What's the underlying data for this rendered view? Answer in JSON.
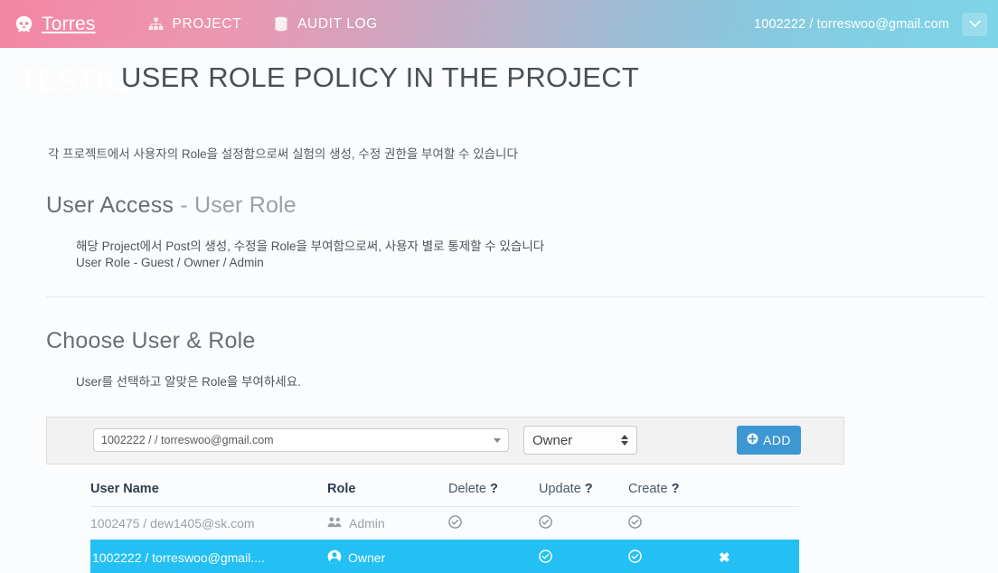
{
  "navbar": {
    "brand": "Torres",
    "brand_icon": "octocat-icon",
    "links": [
      {
        "label": "PROJECT",
        "icon": "sitemap-icon"
      },
      {
        "label": "AUDIT LOG",
        "icon": "database-icon"
      }
    ],
    "user": "1002222 / torreswoo@gmail.com",
    "caret_icon": "chevron-down-icon"
  },
  "page": {
    "project_name": "TEST02",
    "title": "USER ROLE POLICY IN THE PROJECT",
    "lead": "각 프로젝트에서 사용자의 Role을 설정함으로써 실험의 생성, 수정 권한을 부여할 수 있습니다"
  },
  "user_access": {
    "title_main": "User Access",
    "title_dim": "- User Role",
    "line1": "해당 Project에서 Post의 생성, 수정을 Role을 부여함으로써, 사용자 별로 통제할 수 있습니다",
    "line2": "User Role - Guest / Owner / Admin"
  },
  "choose": {
    "title": "Choose User & Role",
    "description": "User를 선택하고 알맞은 Role을 부여하세요."
  },
  "form": {
    "user_select_value": "1002222 / / torreswoo@gmail.com",
    "role_select_value": "Owner",
    "add_label": "ADD",
    "add_icon": "plus-circle-icon",
    "add_color": "#3d97d3"
  },
  "table": {
    "headers": {
      "user_name": "User Name",
      "role": "Role",
      "delete": "Delete",
      "update": "Update",
      "create": "Create",
      "help_mark": "?"
    },
    "rows": [
      {
        "user_name": "1002475 / dew1405@sk.com",
        "role": "Admin",
        "role_icon": "users-icon",
        "delete": "check-circle-icon",
        "update": "check-circle-icon",
        "create": "check-circle-icon",
        "action": "",
        "highlighted": false
      },
      {
        "user_name": "1002222 / torreswoo@gmail....",
        "role": "Owner",
        "role_icon": "user-circle-icon",
        "delete": "",
        "update": "check-circle-icon",
        "create": "check-circle-icon",
        "action": "remove-icon",
        "highlighted": true
      }
    ],
    "highlight_color": "#22c0f3"
  }
}
